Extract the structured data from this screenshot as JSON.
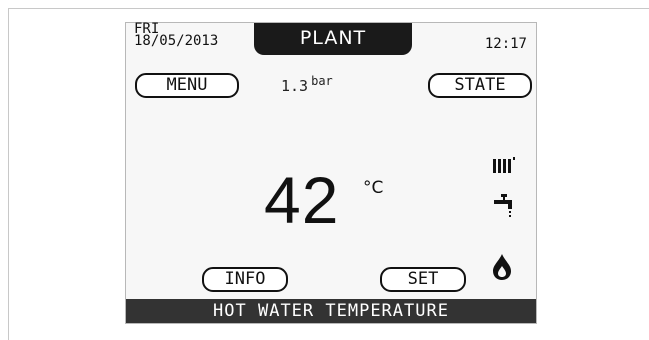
{
  "header": {
    "day": "FRI",
    "date": "18/05/2013",
    "section_title": "PLANT",
    "time": "12:17"
  },
  "buttons": {
    "menu": "MENU",
    "state": "STATE",
    "info": "INFO",
    "set": "SET"
  },
  "pressure": {
    "value": "1.3",
    "unit": "bar"
  },
  "temperature": {
    "value": "42",
    "unit": "°C"
  },
  "status_icons": [
    "radiator-icon",
    "tap-icon",
    "flame-icon"
  ],
  "footer": {
    "label": "HOT WATER TEMPERATURE"
  },
  "colors": {
    "screen_bg": "#f7f7f7",
    "tab_bg": "#1a1a1a",
    "footer_bg": "#333333",
    "text": "#111111"
  }
}
